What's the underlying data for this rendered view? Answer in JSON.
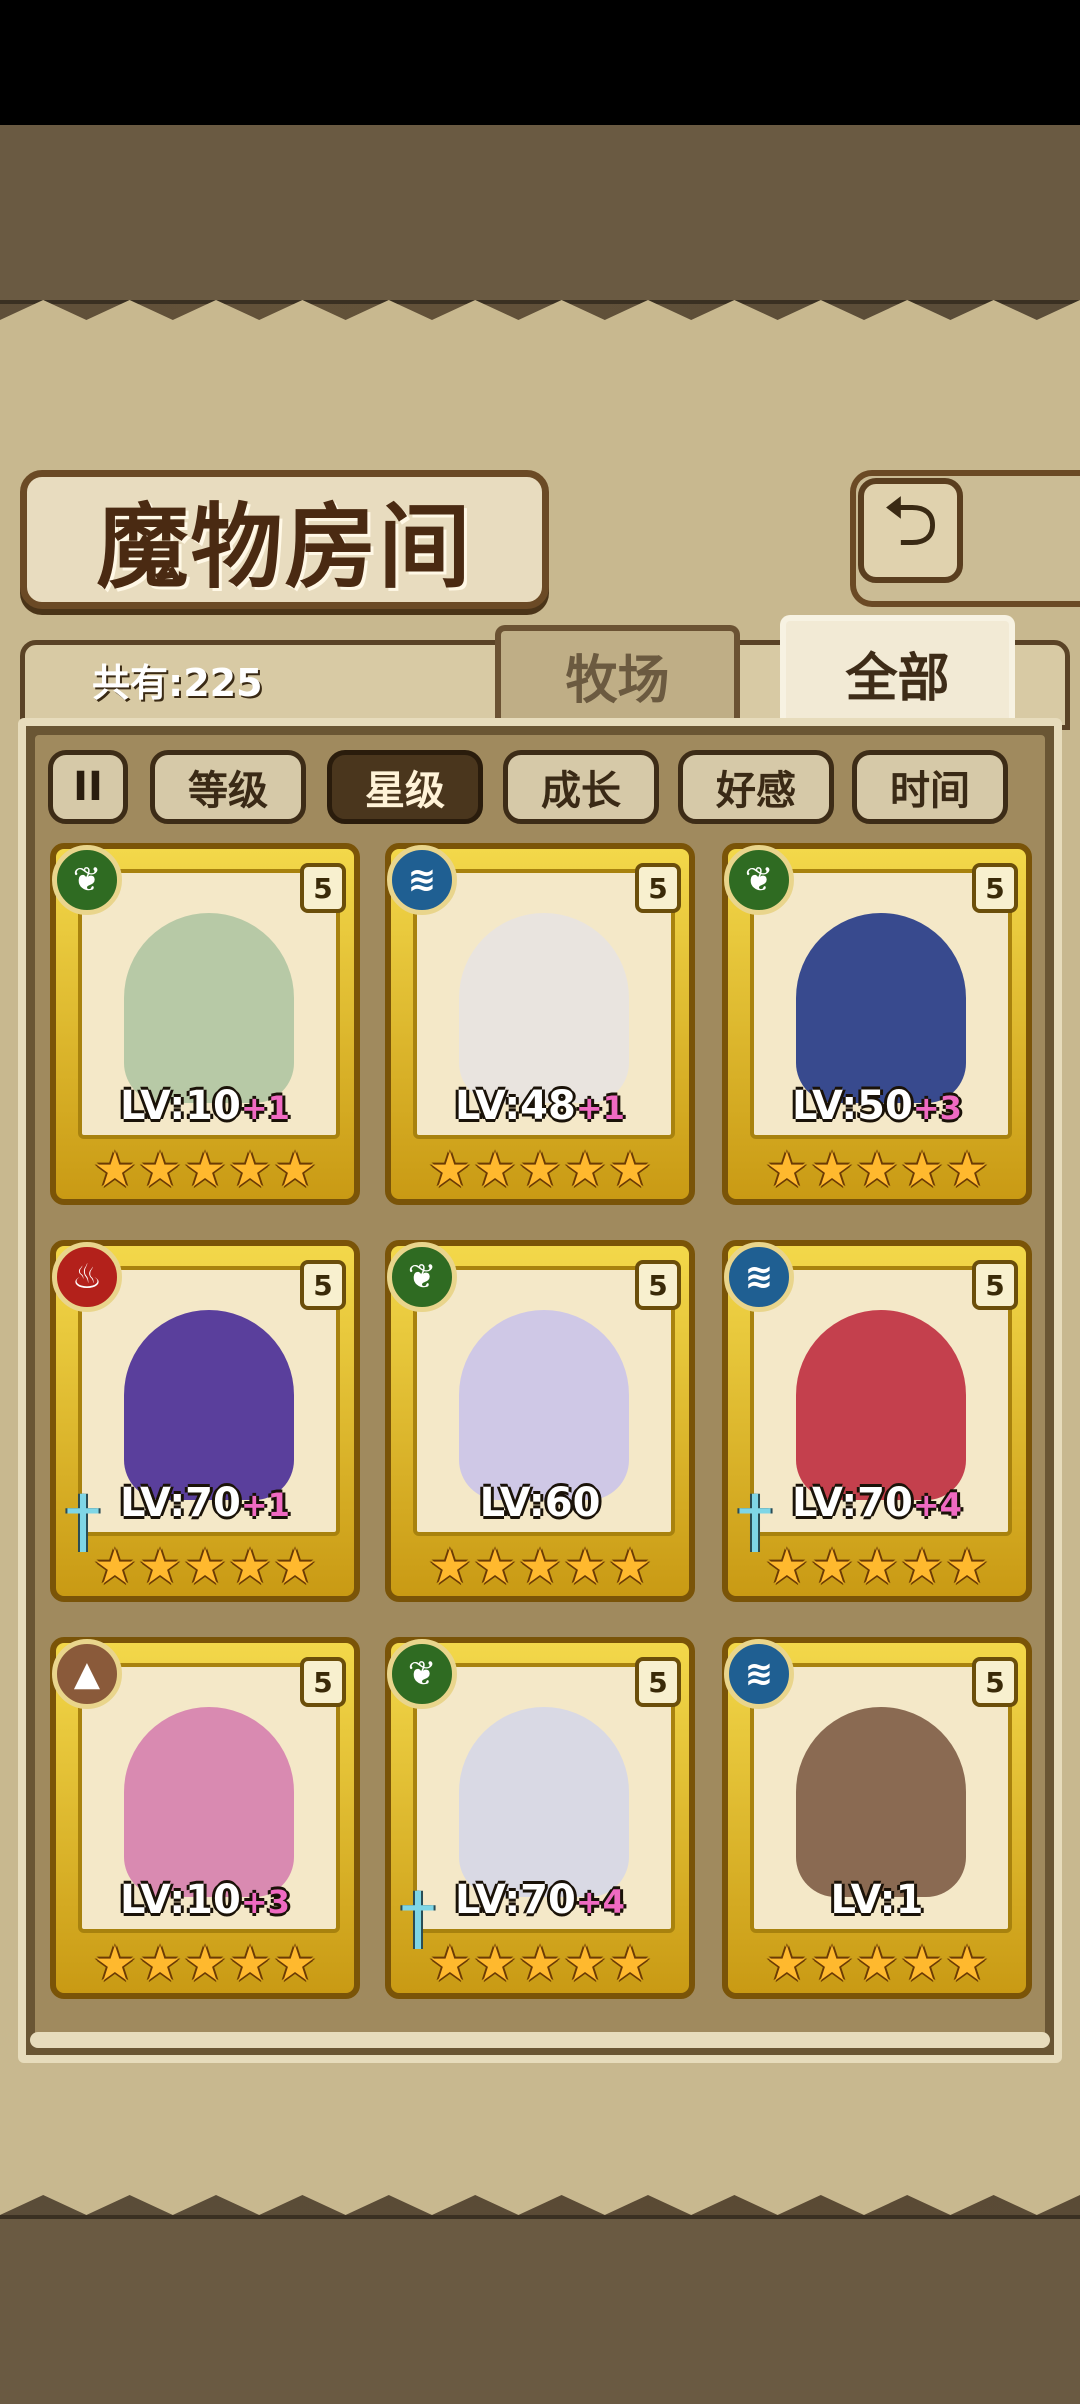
{
  "title": "魔物房间",
  "back_icon": "return-arrow-icon",
  "total": {
    "label": "共有:225"
  },
  "tabs": [
    {
      "label": "牧场",
      "active": false
    },
    {
      "label": "全部",
      "active": true
    }
  ],
  "pause_icon": "pause-icon",
  "pause_glyph": "II",
  "sort_buttons": [
    {
      "label": "等级",
      "active": false
    },
    {
      "label": "星级",
      "active": true
    },
    {
      "label": "成长",
      "active": false
    },
    {
      "label": "好感",
      "active": false
    },
    {
      "label": "时间",
      "active": false
    }
  ],
  "colors": {
    "earth": "#2f6b22",
    "water": "#1f5f92",
    "fire": "#b3211b",
    "rock": "#8a5a3a"
  },
  "monsters": [
    {
      "element": "earth",
      "element_icon": "leaf-icon",
      "rank": "5",
      "level": "LV:10",
      "plus": "+1",
      "stars": 5,
      "weapon": false,
      "portrait": "#b7c9a6"
    },
    {
      "element": "water",
      "element_icon": "water-icon",
      "rank": "5",
      "level": "LV:48",
      "plus": "+1",
      "stars": 5,
      "weapon": false,
      "portrait": "#e9e4df"
    },
    {
      "element": "earth",
      "element_icon": "leaf-icon",
      "rank": "5",
      "level": "LV:50",
      "plus": "+3",
      "stars": 5,
      "weapon": false,
      "portrait": "#384a8e"
    },
    {
      "element": "fire",
      "element_icon": "fire-icon",
      "rank": "5",
      "level": "LV:70",
      "plus": "+1",
      "stars": 5,
      "weapon": true,
      "portrait": "#5a3f9c"
    },
    {
      "element": "earth",
      "element_icon": "leaf-icon",
      "rank": "5",
      "level": "LV:60",
      "plus": "",
      "stars": 5,
      "weapon": false,
      "portrait": "#cfc8e6"
    },
    {
      "element": "water",
      "element_icon": "water-icon",
      "rank": "5",
      "level": "LV:70",
      "plus": "+4",
      "stars": 5,
      "weapon": true,
      "portrait": "#c4404d"
    },
    {
      "element": "rock",
      "element_icon": "mountain-icon",
      "rank": "5",
      "level": "LV:10",
      "plus": "+3",
      "stars": 5,
      "weapon": false,
      "portrait": "#d98ab1"
    },
    {
      "element": "earth",
      "element_icon": "leaf-icon",
      "rank": "5",
      "level": "LV:70",
      "plus": "+4",
      "stars": 5,
      "weapon": true,
      "portrait": "#d9d9e4"
    },
    {
      "element": "water",
      "element_icon": "water-icon",
      "rank": "5",
      "level": "LV:1",
      "plus": "",
      "stars": 5,
      "weapon": false,
      "portrait": "#8a6a52"
    }
  ]
}
